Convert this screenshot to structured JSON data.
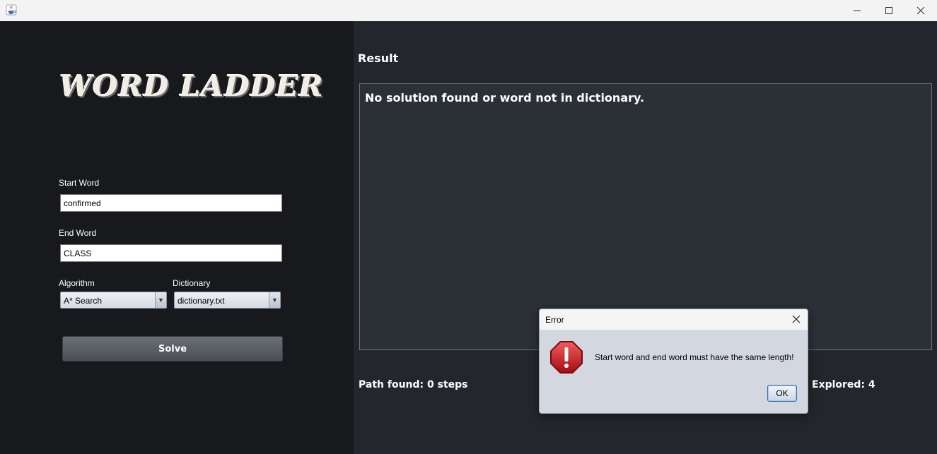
{
  "window": {
    "icon": "java-cup-icon",
    "controls": [
      "minimize-icon",
      "maximize-icon",
      "close-icon"
    ]
  },
  "left_panel": {
    "logo_text": "WORD LADDER",
    "start_word": {
      "label": "Start Word",
      "value": "confirmed"
    },
    "end_word": {
      "label": "End Word",
      "value": "CLASS"
    },
    "algorithm": {
      "label": "Algorithm",
      "selected": "A* Search"
    },
    "dictionary": {
      "label": "Dictionary",
      "selected": "dictionary.txt"
    },
    "solve_label": "Solve"
  },
  "right_panel": {
    "result_title": "Result",
    "result_text": "No solution found or word not in dictionary.",
    "path_found": "Path found: 0 steps",
    "explored_partial": "Explored: 4"
  },
  "dialog": {
    "title": "Error",
    "message": "Start word and end word must have the same length!",
    "ok_label": "OK",
    "icon": "error-stop-icon"
  },
  "colors": {
    "left_bg": "#17191c",
    "right_bg": "#23272d",
    "result_bg": "#2b3037",
    "dialog_bg": "#d3d7df",
    "error_red": "#c8161d"
  }
}
